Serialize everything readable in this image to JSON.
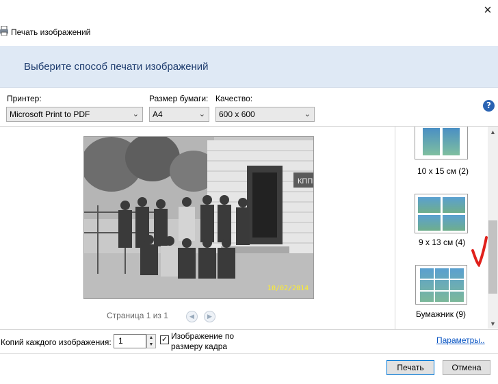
{
  "window": {
    "title": "Печать изображений",
    "close_glyph": "×"
  },
  "header": {
    "heading": "Выберите способ печати изображений"
  },
  "settings": {
    "printer_label": "Принтер:",
    "printer_value": "Microsoft Print to PDF",
    "paper_size_label": "Размер бумаги:",
    "paper_size_value": "A4",
    "quality_label": "Качество:",
    "quality_value": "600 x 600",
    "help_glyph": "?"
  },
  "preview": {
    "photo_date_stamp": "10/02/2014",
    "sign_text": "КПП",
    "page_indicator": "Страница 1 из 1"
  },
  "layouts": {
    "items": [
      {
        "label": "10 x 15 см (2)",
        "grid": "2x1"
      },
      {
        "label": "9 x 13 см (4)",
        "grid": "2x2"
      },
      {
        "label": "Бумажник (9)",
        "grid": "3x3"
      }
    ]
  },
  "bottom": {
    "copies_label": "Копий каждого изображения:",
    "copies_value": "1",
    "fit_checked": true,
    "fit_label": "Изображение по размеру кадра",
    "options_link": "Параметры.."
  },
  "footer": {
    "print_button": "Печать",
    "cancel_button": "Отмена"
  },
  "colors": {
    "header_band": "#dfe9f5",
    "header_text": "#1e3c6e",
    "link": "#0b56c4",
    "annotation": "#e0201b"
  }
}
